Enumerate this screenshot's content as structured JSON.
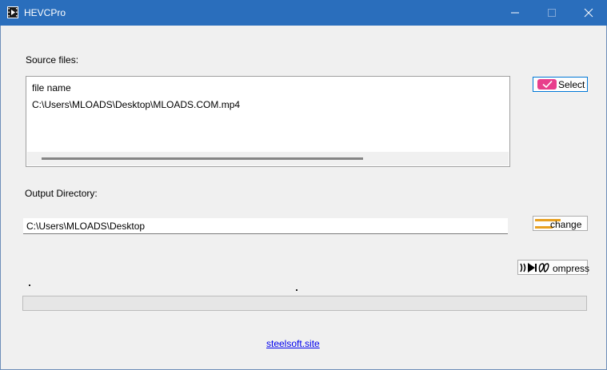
{
  "window": {
    "title": "HEVCPro"
  },
  "source": {
    "label": "Source files:",
    "list_header": "file name",
    "files": [
      "C:\\Users\\MLOADS\\Desktop\\MLOADS.COM.mp4"
    ],
    "select_label": "Select"
  },
  "output": {
    "label": "Output Directory:",
    "path": "C:\\Users\\MLOADS\\Desktop",
    "change_label": "change"
  },
  "compress": {
    "label": "ompress"
  },
  "progress": {
    "value": 0
  },
  "footer": {
    "link": "steelsoft.site"
  },
  "colors": {
    "titlebar": "#2a6ebc",
    "select_icon": "#e83e8c",
    "change_icon": "#e8a020",
    "link": "#0000ee"
  }
}
